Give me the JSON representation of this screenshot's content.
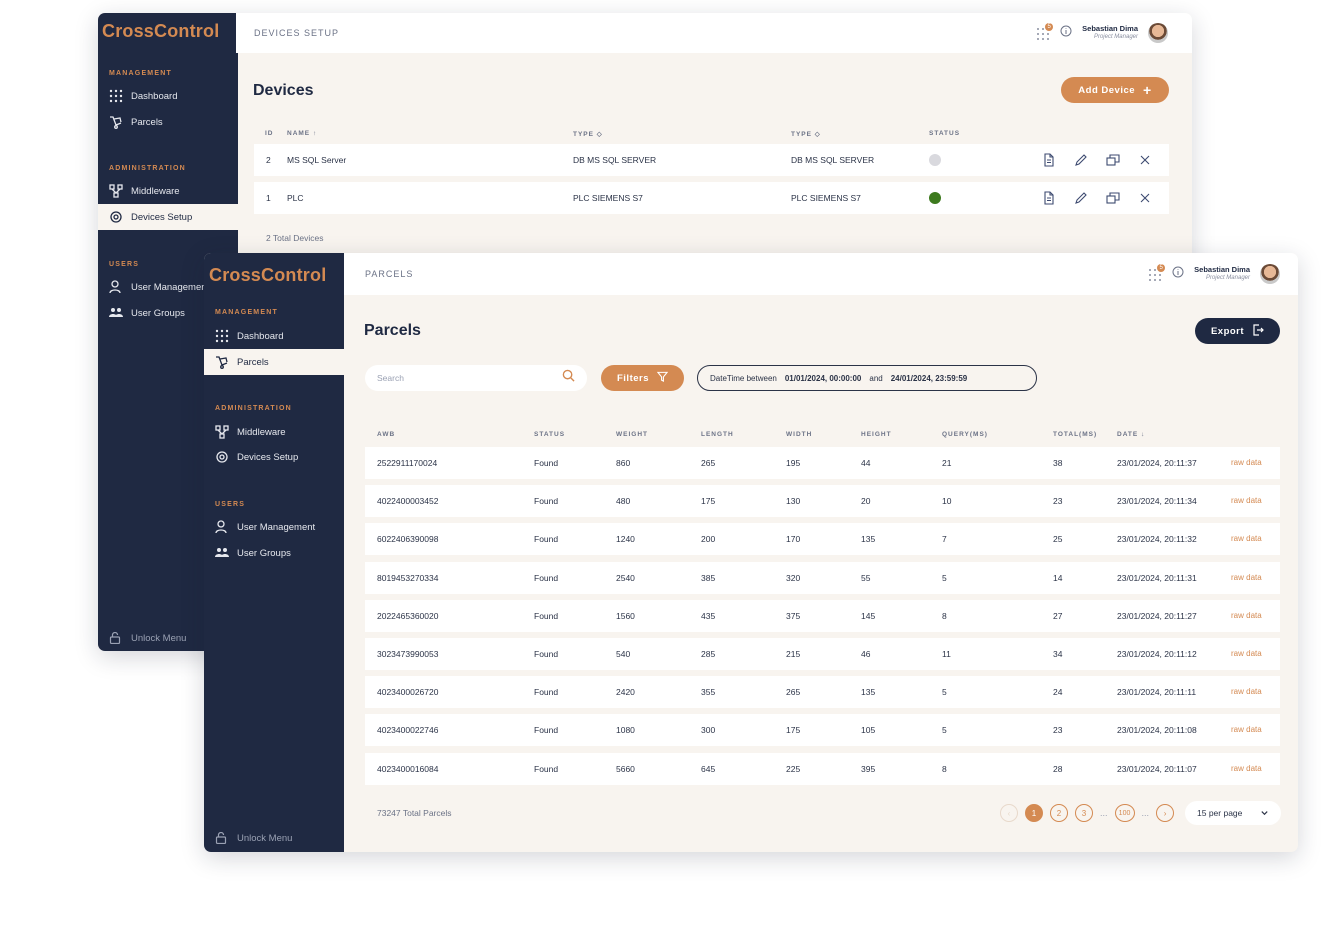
{
  "brand": "CrossControl",
  "user": {
    "name": "Sebastian Dima",
    "role": "Project Manager",
    "notifications": "5"
  },
  "sidebar": {
    "management_title": "MANAGEMENT",
    "administration_title": "ADMINISTRATION",
    "users_title": "USERS",
    "dashboard": "Dashboard",
    "parcels": "Parcels",
    "middleware": "Middleware",
    "devices_setup": "Devices Setup",
    "user_management": "User Management",
    "user_groups": "User Groups",
    "unlock": "Unlock Menu"
  },
  "devices": {
    "breadcrumb": "DEVICES SETUP",
    "title": "Devices",
    "add_label": "Add Device",
    "headers": {
      "id": "ID",
      "name": "NAME ↑",
      "type1": "TYPE ◇",
      "type2": "TYPE ◇",
      "status": "STATUS"
    },
    "rows": [
      {
        "id": "2",
        "name": "MS SQL Server",
        "type1": "DB MS SQL SERVER",
        "type2": "DB MS SQL SERVER",
        "status_color": "#d9d9de"
      },
      {
        "id": "1",
        "name": "PLC",
        "type1": "PLC SIEMENS S7",
        "type2": "PLC SIEMENS S7",
        "status_color": "#3d7a1e"
      }
    ],
    "total": "2 Total Devices"
  },
  "parcels": {
    "breadcrumb": "PARCELS",
    "title": "Parcels",
    "export_label": "Export",
    "search_placeholder": "Search",
    "filters_label": "Filters",
    "date_filter": {
      "prefix": "DateTime between",
      "from": "01/01/2024, 00:00:00",
      "and": "and",
      "to": "24/01/2024, 23:59:59"
    },
    "headers": {
      "awb": "AWB",
      "status": "STATUS",
      "weight": "WEIGHT",
      "length": "LENGTH",
      "width": "WIDTH",
      "height": "HEIGHT",
      "query": "QUERY(MS)",
      "total": "TOTAL(MS)",
      "date": "DATE ↓"
    },
    "rows": [
      {
        "awb": "2522911170024",
        "status": "Found",
        "weight": "860",
        "length": "265",
        "width": "195",
        "height": "44",
        "query": "21",
        "total": "38",
        "date": "23/01/2024, 20:11:37",
        "raw": "raw data"
      },
      {
        "awb": "4022400003452",
        "status": "Found",
        "weight": "480",
        "length": "175",
        "width": "130",
        "height": "20",
        "query": "10",
        "total": "23",
        "date": "23/01/2024, 20:11:34",
        "raw": "raw data"
      },
      {
        "awb": "6022406390098",
        "status": "Found",
        "weight": "1240",
        "length": "200",
        "width": "170",
        "height": "135",
        "query": "7",
        "total": "25",
        "date": "23/01/2024, 20:11:32",
        "raw": "raw data"
      },
      {
        "awb": "8019453270334",
        "status": "Found",
        "weight": "2540",
        "length": "385",
        "width": "320",
        "height": "55",
        "query": "5",
        "total": "14",
        "date": "23/01/2024, 20:11:31",
        "raw": "raw data"
      },
      {
        "awb": "2022465360020",
        "status": "Found",
        "weight": "1560",
        "length": "435",
        "width": "375",
        "height": "145",
        "query": "8",
        "total": "27",
        "date": "23/01/2024, 20:11:27",
        "raw": "raw data"
      },
      {
        "awb": "3023473990053",
        "status": "Found",
        "weight": "540",
        "length": "285",
        "width": "215",
        "height": "46",
        "query": "11",
        "total": "34",
        "date": "23/01/2024, 20:11:12",
        "raw": "raw data"
      },
      {
        "awb": "4023400026720",
        "status": "Found",
        "weight": "2420",
        "length": "355",
        "width": "265",
        "height": "135",
        "query": "5",
        "total": "24",
        "date": "23/01/2024, 20:11:11",
        "raw": "raw data"
      },
      {
        "awb": "4023400022746",
        "status": "Found",
        "weight": "1080",
        "length": "300",
        "width": "175",
        "height": "105",
        "query": "5",
        "total": "23",
        "date": "23/01/2024, 20:11:08",
        "raw": "raw data"
      },
      {
        "awb": "4023400016084",
        "status": "Found",
        "weight": "5660",
        "length": "645",
        "width": "225",
        "height": "395",
        "query": "8",
        "total": "28",
        "date": "23/01/2024, 20:11:07",
        "raw": "raw data"
      }
    ],
    "total": "73247 Total Parcels",
    "pagination": {
      "pages": [
        "1",
        "2",
        "3"
      ],
      "ellipsis": "...",
      "last": "100",
      "current": "1"
    },
    "per_page": "15 per page"
  },
  "colors": {
    "accent": "#d48a52",
    "navy": "#1f2942",
    "background": "#f8f4ef"
  }
}
